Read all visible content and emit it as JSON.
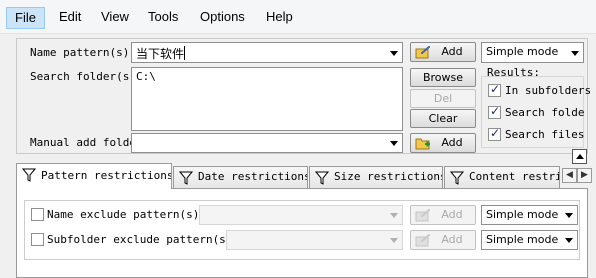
{
  "menubar": {
    "items": [
      "File",
      "Edit",
      "View",
      "Tools",
      "Options",
      "Help"
    ]
  },
  "form": {
    "name_pattern_label": "Name pattern(s):",
    "name_pattern_value": "当下软件",
    "search_folder_label": "Search folder(s):",
    "search_folder_value": "C:\\",
    "manual_add_label": "Manual add folder",
    "manual_add_value": ""
  },
  "buttons": {
    "add": "Add",
    "browse": "Browse",
    "del": "Del",
    "clear": "Clear"
  },
  "mode": {
    "selected": "Simple mode"
  },
  "results": {
    "label": "Results:",
    "options": [
      {
        "label": "In subfolders",
        "checked": true
      },
      {
        "label": "Search folders",
        "checked": true
      },
      {
        "label": "Search files",
        "checked": true
      }
    ]
  },
  "tabs": [
    "Pattern restrictions",
    "Date restrictions",
    "Size restrictions",
    "Content restrictions"
  ],
  "restrictions": {
    "name_exclude_label": "Name exclude pattern(s):",
    "subfolder_exclude_label": "Subfolder exclude pattern(s):",
    "add_label": "Add",
    "mode_label": "Simple mode"
  },
  "colors": {
    "menu_active_bg": "#cce4f7",
    "window_bg": "#f0f0f0",
    "disabled_text": "#a8a8a8"
  }
}
